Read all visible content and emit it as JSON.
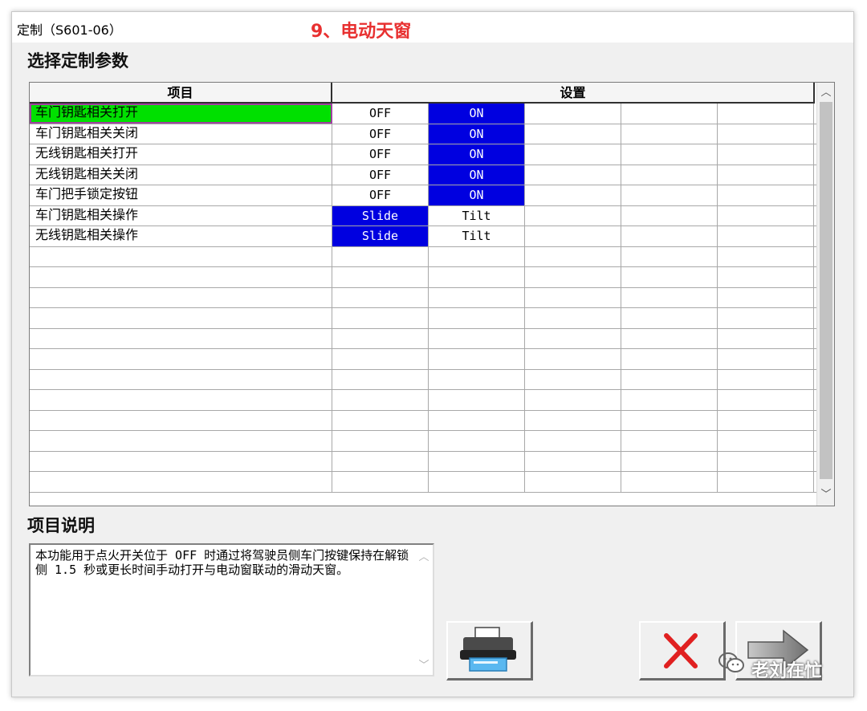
{
  "window": {
    "title": "定制（S601-06）",
    "overlay_title": "9、电动天窗"
  },
  "main": {
    "section_title": "选择定制参数",
    "grid": {
      "headers": {
        "item": "项目",
        "setting": "设置"
      },
      "rows": [
        {
          "item": "车门钥匙相关打开",
          "selected": true,
          "options": [
            {
              "label": "OFF",
              "active": false
            },
            {
              "label": "ON",
              "active": true
            }
          ]
        },
        {
          "item": "车门钥匙相关关闭",
          "selected": false,
          "options": [
            {
              "label": "OFF",
              "active": false
            },
            {
              "label": "ON",
              "active": true
            }
          ]
        },
        {
          "item": "无线钥匙相关打开",
          "selected": false,
          "options": [
            {
              "label": "OFF",
              "active": false
            },
            {
              "label": "ON",
              "active": true
            }
          ]
        },
        {
          "item": "无线钥匙相关关闭",
          "selected": false,
          "options": [
            {
              "label": "OFF",
              "active": false
            },
            {
              "label": "ON",
              "active": true
            }
          ]
        },
        {
          "item": "车门把手锁定按钮",
          "selected": false,
          "options": [
            {
              "label": "OFF",
              "active": false
            },
            {
              "label": "ON",
              "active": true
            }
          ]
        },
        {
          "item": "车门钥匙相关操作",
          "selected": false,
          "options": [
            {
              "label": "Slide",
              "active": true
            },
            {
              "label": "Tilt",
              "active": false
            }
          ]
        },
        {
          "item": "无线钥匙相关操作",
          "selected": false,
          "options": [
            {
              "label": "Slide",
              "active": true
            },
            {
              "label": "Tilt",
              "active": false
            }
          ]
        }
      ],
      "empty_row_count": 12
    },
    "description": {
      "title": "项目说明",
      "text": "本功能用于点火开关位于 OFF 时通过将驾驶员侧车门按键保持在解锁侧 1.5 秒或更长时间手动打开与电动窗联动的滑动天窗。"
    }
  },
  "buttons": [
    {
      "name": "print-button",
      "icon": "printer-icon"
    },
    {
      "name": "cancel-button",
      "icon": "red-x-icon"
    },
    {
      "name": "next-button",
      "icon": "arrow-right-icon"
    }
  ],
  "watermark": {
    "text": "老刘在忙",
    "icon": "wechat-icon"
  },
  "colors": {
    "selected_row": "#00e000",
    "active_option": "#0000e0",
    "title_overlay": "#e83030"
  }
}
